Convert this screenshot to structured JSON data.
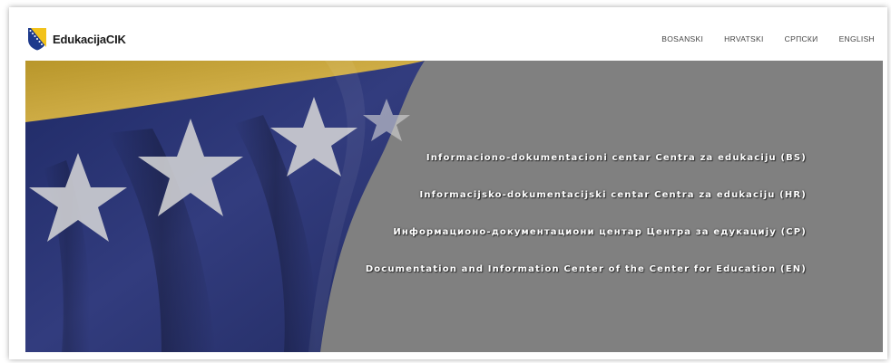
{
  "brand": {
    "name": "EdukacijaCIK",
    "logo_icon": "bih-flag-shield-icon"
  },
  "languages": [
    {
      "label": "BOSANSKI"
    },
    {
      "label": "HRVATSKI"
    },
    {
      "label": "СРПСКИ"
    },
    {
      "label": "ENGLISH"
    }
  ],
  "hero": {
    "links": [
      {
        "label": "Informaciono-dokumentacioni centar Centra za edukaciju (BS)"
      },
      {
        "label": "Informacijsko-dokumentacijski centar Centra za edukaciju (HR)"
      },
      {
        "label": "Информационо-документациони центар Центра за едукацију (СР)"
      },
      {
        "label": "Documentation and Information Center of the Center for Education (EN)"
      }
    ],
    "background_color": "#808080",
    "flag_blue": "#2b3577",
    "flag_yellow": "#c8a42e"
  }
}
